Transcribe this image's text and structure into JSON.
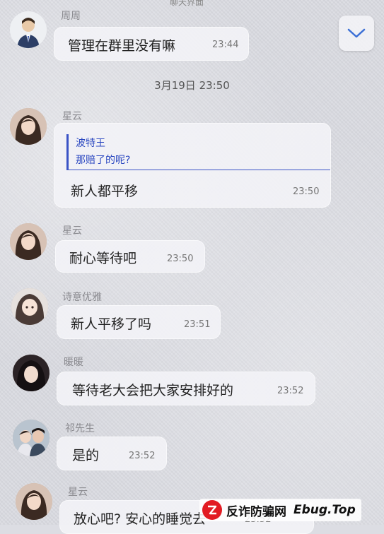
{
  "header": {
    "fragment": "聊天界面"
  },
  "scroll_button": {
    "icon": "chevron-down-icon",
    "color": "#3b6fd6"
  },
  "date_separator": "3月19日 23:50",
  "messages": [
    {
      "sender": "周周",
      "text": "管理在群里没有嘛",
      "time": "23:44",
      "avatar": "avatar-default-man"
    },
    {
      "sender": "星云",
      "quote_name": "波特王",
      "quote_text": "那赔了的呢?",
      "text": "新人都平移",
      "time": "23:50",
      "avatar": "avatar-woman"
    },
    {
      "sender": "星云",
      "text": "耐心等待吧",
      "time": "23:50",
      "avatar": "avatar-woman"
    },
    {
      "sender": "诗意优雅",
      "text": "新人平移了吗",
      "time": "23:51",
      "avatar": "avatar-anime-girl"
    },
    {
      "sender": "暖暖",
      "text": "等待老大会把大家安排好的",
      "time": "23:52",
      "avatar": "avatar-woman-dark"
    },
    {
      "sender": "祁先生",
      "text": "是的",
      "time": "23:52",
      "avatar": "avatar-couple"
    },
    {
      "sender": "星云",
      "text": "放心吧? 安心的睡觉去",
      "time": "23:52",
      "avatar": "avatar-woman"
    }
  ],
  "watermark": {
    "cn": "反诈防骗网",
    "en": "Ebug.Top",
    "brand_color": "#e21b23"
  }
}
